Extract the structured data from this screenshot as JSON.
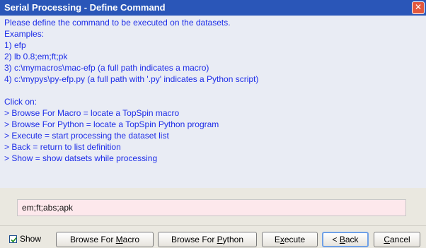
{
  "window": {
    "title": "Serial Processing - Define Command"
  },
  "instructions": {
    "lines": [
      "Please define the command to be executed on the datasets.",
      "Examples:",
      "1) efp",
      "2) lb 0.8;em;ft;pk",
      "3) c:\\mymacros\\mac-efp (a full path indicates a macro)",
      "4) c:\\mypys\\py-efp.py (a full path with '.py' indicates a Python script)",
      "",
      "Click on:",
      "> Browse For Macro = locate a TopSpin macro",
      "> Browse For Python = locate a TopSpin Python program",
      "> Execute = start processing the dataset list",
      "> Back = return to list definition",
      "> Show = show datsets while processing"
    ]
  },
  "command": {
    "value": "em;ft;abs;apk"
  },
  "footer": {
    "show_label": "Show",
    "show_checked": true,
    "buttons": {
      "browse_macro": {
        "pre": "Browse For ",
        "key": "M",
        "post": "acro"
      },
      "browse_python": {
        "pre": "Browse For ",
        "key": "P",
        "post": "ython"
      },
      "execute": {
        "pre": "E",
        "key": "x",
        "post": "ecute"
      },
      "back": {
        "pre": "< ",
        "key": "B",
        "post": "ack"
      },
      "cancel": {
        "pre": "",
        "key": "C",
        "post": "ancel"
      }
    }
  },
  "colors": {
    "title_bar": "#2a56b8",
    "instruction_text": "#1d2de8",
    "input_background": "#fde8ec",
    "close_button": "#e2573d"
  }
}
